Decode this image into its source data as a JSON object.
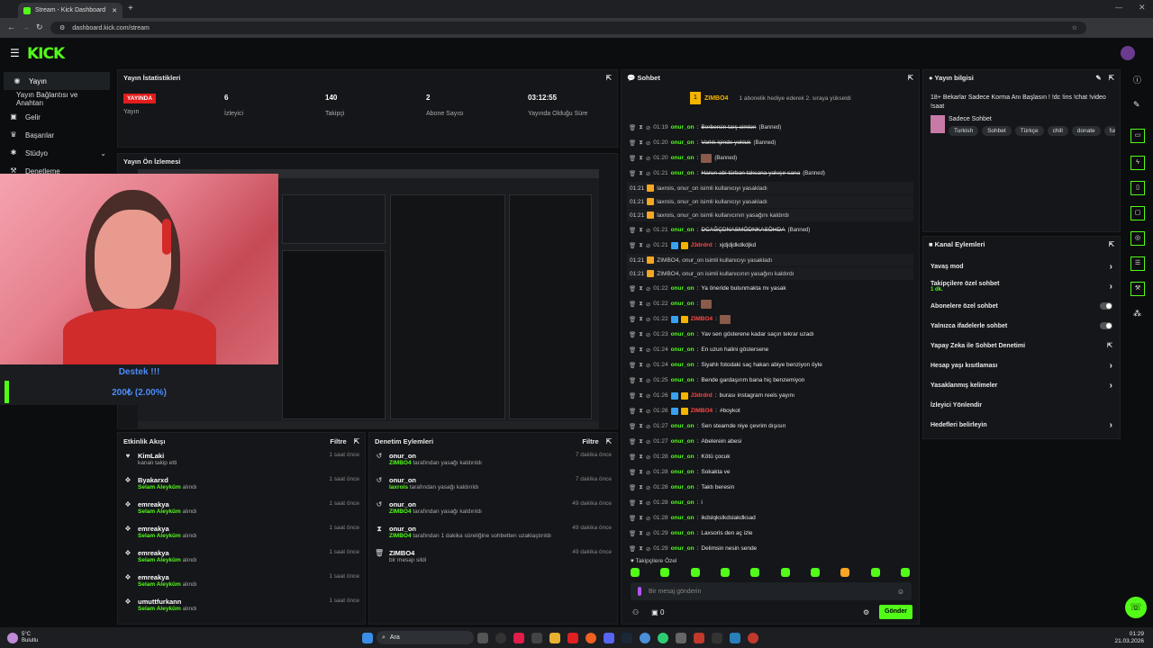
{
  "browser": {
    "tab_title": "Stream - Kick Dashboard",
    "url": "dashboard.kick.com/stream"
  },
  "brand": {
    "logo": "KICK",
    "accent": "#53fc18"
  },
  "sidebar": {
    "items": [
      {
        "label": "Yayın",
        "icon": "broadcast-icon"
      },
      {
        "label": "Yayın Bağlantısı ve Anahtarı",
        "icon": "link-icon"
      },
      {
        "label": "Gelir",
        "icon": "money-icon"
      },
      {
        "label": "Başarılar",
        "icon": "trophy-icon"
      },
      {
        "label": "Stüdyo",
        "icon": "palette-icon"
      },
      {
        "label": "Denetleme",
        "icon": "hammer-icon"
      }
    ]
  },
  "stats": {
    "title": "Yayın İstatistikleri",
    "items": [
      {
        "value": "YAYINDA",
        "label": "Yayın"
      },
      {
        "value": "6",
        "label": "İzleyici"
      },
      {
        "value": "140",
        "label": "Takipçi"
      },
      {
        "value": "2",
        "label": "Abone Sayısı"
      },
      {
        "value": "03:12:55",
        "label": "Yayında Olduğu Süre"
      }
    ]
  },
  "preview": {
    "title": "Yayın Ön İzlemesi",
    "support_text": "Destek !!!",
    "goal_text": "200₺ (2.00%)"
  },
  "activity": {
    "title": "Etkinlik Akışı",
    "filter": "Filtre",
    "items": [
      {
        "name": "KimLaki",
        "desc": "kanalı takip etti",
        "highlight": "",
        "time": "1 saat önce",
        "icon": "heart-icon"
      },
      {
        "name": "Byakarxd",
        "highlight": "Selam Aleyküm",
        "desc": "alındı",
        "time": "1 saat önce",
        "icon": "gift-icon"
      },
      {
        "name": "emreakya",
        "highlight": "Selam Aleyküm",
        "desc": "alındı",
        "time": "1 saat önce",
        "icon": "gift-icon"
      },
      {
        "name": "emreakya",
        "highlight": "Selam Aleyküm",
        "desc": "alındı",
        "time": "1 saat önce",
        "icon": "gift-icon"
      },
      {
        "name": "emreakya",
        "highlight": "Selam Aleyküm",
        "desc": "alındı",
        "time": "1 saat önce",
        "icon": "gift-icon"
      },
      {
        "name": "emreakya",
        "highlight": "Selam Aleyküm",
        "desc": "alındı",
        "time": "1 saat önce",
        "icon": "gift-icon"
      },
      {
        "name": "umuttfurkann",
        "highlight": "Selam Aleyküm",
        "desc": "alındı",
        "time": "1 saat önce",
        "icon": "gift-icon"
      }
    ]
  },
  "moderation": {
    "title": "Denetim Eylemleri",
    "filter": "Filtre",
    "items": [
      {
        "name": "onur_on",
        "highlight": "ZIMBO4",
        "desc": "tarafından yasağı kaldırıldı",
        "time": "7 dakika önce",
        "icon": "undo-icon"
      },
      {
        "name": "onur_on",
        "highlight": "laxrois",
        "desc": "tarafından yasağı kaldırıldı",
        "time": "7 dakika önce",
        "icon": "undo-icon"
      },
      {
        "name": "onur_on",
        "highlight": "ZIMBO4",
        "desc": "tarafından yasağı kaldırıldı",
        "time": "49 dakika önce",
        "icon": "undo-icon"
      },
      {
        "name": "onur_on",
        "highlight": "ZIMBO4",
        "desc": "tarafından 1 dakika süreliğine sohbetten uzaklaştırıldı",
        "time": "49 dakika önce",
        "icon": "hourglass-icon"
      },
      {
        "name": "ZIMBO4",
        "highlight": "",
        "desc": "bir mesajı sildi",
        "time": "49 dakika önce",
        "icon": "trash-icon"
      }
    ]
  },
  "chat": {
    "title": "Sohbet",
    "pinned_user": "ZIMBO4",
    "pinned_note": "1 abonelik hediye ederek 2. sıraya yükseldi",
    "lines": [
      {
        "time": "01:19",
        "user": "onur_on",
        "msg": "Berbersin tarş cimlon",
        "strike": true,
        "banned": "(Banned)"
      },
      {
        "time": "01:20",
        "user": "onur_on",
        "msg": "Varlık içinde yokluk",
        "strike": true,
        "banned": "(Banned)"
      },
      {
        "time": "01:20",
        "user": "onur_on",
        "msg": "",
        "strike": false,
        "banned": "(Banned)"
      },
      {
        "time": "01:21",
        "user": "onur_on",
        "msg": "Harun abi türban taksana yakışır sana",
        "strike": true,
        "banned": "(Banned)"
      },
      {
        "sys": true,
        "time": "01:21",
        "text": "laxrois, onur_on isimli kullanıcıyı yasakladı"
      },
      {
        "sys": true,
        "time": "01:21",
        "text": "laxrois, onur_on isimli kullanıcıyı yasakladı"
      },
      {
        "sys": true,
        "time": "01:21",
        "text": "laxrois, onur_on isimli kullanıcının yasağını kaldırdı"
      },
      {
        "time": "01:21",
        "user": "onur_on",
        "msg": "DCAĞÇDNASMÖDNKASÖHDA",
        "strike": true,
        "banned": "(Banned)"
      },
      {
        "time": "01:21",
        "user": "J3drdrd",
        "red": true,
        "msg": "xjdjdjdkdkdjkd",
        "strike": false,
        "banned": ""
      },
      {
        "sys": true,
        "time": "01:21",
        "text": "ZIMBO4, onur_on isimli kullanıcıyı yasakladı"
      },
      {
        "sys": true,
        "time": "01:21",
        "text": "ZIMBO4, onur_on isimli kullanıcının yasağını kaldırdı"
      },
      {
        "time": "01:22",
        "user": "onur_on",
        "msg": "Ya öneride bulunmakta mı yasak",
        "strike": false,
        "banned": ""
      },
      {
        "time": "01:22",
        "user": "onur_on",
        "msg": "",
        "strike": false,
        "banned": ""
      },
      {
        "time": "01:22",
        "user": "ZIMBO4",
        "red": true,
        "msg": "",
        "strike": false,
        "banned": ""
      },
      {
        "time": "01:23",
        "user": "onur_on",
        "msg": "Yav sen gösterene kadar saçın tekrar uzadı",
        "strike": false,
        "banned": ""
      },
      {
        "time": "01:24",
        "user": "onur_on",
        "msg": "En uzun halini göstersene",
        "strike": false,
        "banned": ""
      },
      {
        "time": "01:24",
        "user": "onur_on",
        "msg": "Siyahlı fotodaki saç hakan abiye benziyon öyle",
        "strike": false,
        "banned": ""
      },
      {
        "time": "01:25",
        "user": "onur_on",
        "msg": "Bende gardaşırım bana hiç benzemiyon",
        "strike": false,
        "banned": ""
      },
      {
        "time": "01:26",
        "user": "J3drdrd",
        "red": true,
        "msg": "burası instagram reels yayını",
        "strike": false,
        "banned": ""
      },
      {
        "time": "01:26",
        "user": "ZIMBO4",
        "red": true,
        "msg": "#boykot",
        "strike": false,
        "banned": ""
      },
      {
        "time": "01:27",
        "user": "onur_on",
        "msg": "Sen steamde niye çevrim dışısın",
        "strike": false,
        "banned": ""
      },
      {
        "time": "01:27",
        "user": "onur_on",
        "msg": "Abelerein abesi",
        "strike": false,
        "banned": ""
      },
      {
        "time": "01:28",
        "user": "onur_on",
        "msg": "Kötü çocuk",
        "strike": false,
        "banned": ""
      },
      {
        "time": "01:28",
        "user": "onur_on",
        "msg": "Sokakta ve",
        "strike": false,
        "banned": ""
      },
      {
        "time": "01:28",
        "user": "onur_on",
        "msg": "Taktı beresin",
        "strike": false,
        "banned": ""
      },
      {
        "time": "01:28",
        "user": "onur_on",
        "msg": "i",
        "strike": false,
        "banned": ""
      },
      {
        "time": "01:28",
        "user": "onur_on",
        "msg": "ikdslqkslkdslakdksad",
        "strike": false,
        "banned": ""
      },
      {
        "time": "01:29",
        "user": "onur_on",
        "msg": "Laxsoris den aç izle",
        "strike": false,
        "banned": ""
      },
      {
        "time": "01:29",
        "user": "onur_on",
        "msg": "Delimsin nesin sende",
        "strike": false,
        "banned": ""
      }
    ],
    "followers_only": "Takipçilere Özel",
    "placeholder": "Bir mesaj gönderin",
    "send": "Gönder",
    "count": "0"
  },
  "stream_info": {
    "title": "Yayın bilgisi",
    "stream_title": "18+ Bekarlar Sadece Korma Anı Başlasın ! !dc !ins !chat !video !saat",
    "category": "Sadece Sohbet",
    "tags": [
      "Turkish",
      "Sohbet",
      "Türkçe",
      "chill",
      "donate",
      "funn"
    ]
  },
  "channel_actions": {
    "title": "Kanal Eylemleri",
    "items": [
      {
        "label": "Yavaş mod",
        "sub": "",
        "control": "chevron"
      },
      {
        "label": "Takipçilere özel sohbet",
        "sub": "1 dk.",
        "control": "chevron"
      },
      {
        "label": "Abonelere özel sohbet",
        "sub": "",
        "control": "toggle"
      },
      {
        "label": "Yalnızca ifadelerle sohbet",
        "sub": "",
        "control": "toggle"
      },
      {
        "label": "Yapay Zeka ile Sohbet Denetimi",
        "sub": "",
        "control": "external"
      },
      {
        "label": "Hesap yaşı kısıtlaması",
        "sub": "",
        "control": "chevron"
      },
      {
        "label": "Yasaklanmış kelimeler",
        "sub": "",
        "control": "chevron"
      },
      {
        "label": "İzleyici Yönlendir",
        "sub": "",
        "control": "none"
      },
      {
        "label": "Hedefleri belirleyin",
        "sub": "",
        "control": "chevron"
      }
    ]
  },
  "taskbar": {
    "weather_temp": "5°C",
    "weather_text": "Bulutlu",
    "search": "Ara",
    "time": "01:29",
    "date": "21.03.2026"
  }
}
